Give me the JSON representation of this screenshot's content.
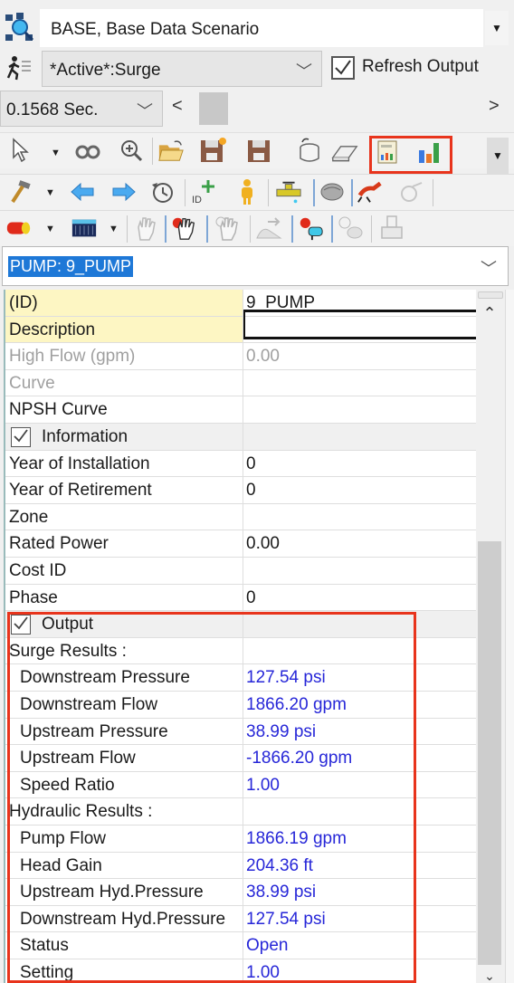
{
  "scenario": {
    "value": "BASE, Base Data Scenario",
    "icon": "scenario-network-icon"
  },
  "active": {
    "value": "*Active*:Surge",
    "icon": "runner-icon"
  },
  "refresh_output": {
    "label": "Refresh Output",
    "checked": true
  },
  "time": {
    "value": "0.1568 Sec."
  },
  "toolbar": {
    "row1": [
      "pointer-select-icon",
      "binoculars-icon",
      "zoom-in-icon",
      "open-folder-icon",
      "new-save-icon",
      "save-icon",
      "database-undo-icon",
      "eraser-icon",
      "report-icon",
      "bar-chart-icon"
    ],
    "row2": [
      "hammer-icon",
      "back-arrow-icon",
      "forward-arrow-icon",
      "history-icon",
      "new-id-icon",
      "person-icon",
      "valve-icon",
      "hand-icon",
      "runner-icon",
      "runner-disabled-icon"
    ],
    "row3": [
      "red-light-icon",
      "calculator-icon",
      "hand-disabled-icon",
      "hand-select-icon",
      "hand-multi-icon",
      "wave-icon",
      "pump-valve-icon",
      "hand-flower-icon",
      "tank-icon"
    ]
  },
  "element": {
    "selected": "PUMP: 9_PUMP"
  },
  "properties": {
    "rows": [
      {
        "key": "(ID)",
        "value": "9_PUMP",
        "style": "yellow"
      },
      {
        "key": "Description",
        "value": "",
        "style": "yellow"
      },
      {
        "key": "High Flow (gpm)",
        "value": "0.00",
        "style": "grey"
      },
      {
        "key": "Curve",
        "value": "",
        "style": "grey"
      },
      {
        "key": "NPSH Curve",
        "value": "",
        "style": ""
      },
      {
        "key": "Information",
        "value": "",
        "style": "cat"
      },
      {
        "key": "Year of Installation",
        "value": "0",
        "style": ""
      },
      {
        "key": "Year of Retirement",
        "value": "0",
        "style": ""
      },
      {
        "key": "Zone",
        "value": "",
        "style": ""
      },
      {
        "key": "Rated Power",
        "value": "0.00",
        "style": ""
      },
      {
        "key": "Cost ID",
        "value": "",
        "style": ""
      },
      {
        "key": "Phase",
        "value": "0",
        "style": ""
      },
      {
        "key": "Output",
        "value": "",
        "style": "cat"
      },
      {
        "key": "Surge Results :",
        "value": "",
        "style": "group"
      },
      {
        "key": "Downstream Pressure",
        "value": "127.54 psi",
        "style": "sub"
      },
      {
        "key": "Downstream Flow",
        "value": "1866.20 gpm",
        "style": "sub"
      },
      {
        "key": "Upstream Pressure",
        "value": "38.99 psi",
        "style": "sub"
      },
      {
        "key": "Upstream Flow",
        "value": "-1866.20 gpm",
        "style": "sub"
      },
      {
        "key": "Speed Ratio",
        "value": "1.00",
        "style": "sub"
      },
      {
        "key": "Hydraulic Results :",
        "value": "",
        "style": "group"
      },
      {
        "key": "Pump Flow",
        "value": "1866.19 gpm",
        "style": "sub"
      },
      {
        "key": "Head Gain",
        "value": "204.36 ft",
        "style": "sub"
      },
      {
        "key": "Upstream Hyd.Pressure",
        "value": "38.99 psi",
        "style": "sub"
      },
      {
        "key": "Downstream Hyd.Pressure",
        "value": "127.54 psi",
        "style": "sub"
      },
      {
        "key": "Status",
        "value": "Open",
        "style": "sub"
      },
      {
        "key": "Setting",
        "value": "1.00",
        "style": "sub"
      }
    ]
  },
  "colors": {
    "highlight_box": "#e8341c",
    "output_value": "#2727d8",
    "selection": "#1e78d7",
    "key_highlight": "#fdf6c3"
  }
}
